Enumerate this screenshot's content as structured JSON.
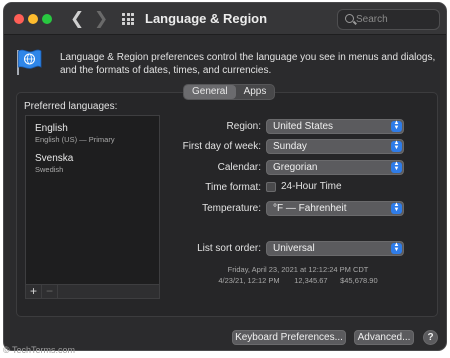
{
  "window": {
    "title": "Language & Region"
  },
  "search": {
    "placeholder": "Search"
  },
  "description": "Language & Region preferences control the language you see in menus and dialogs, and the formats of dates, times, and currencies.",
  "tabs": [
    {
      "label": "General",
      "active": true
    },
    {
      "label": "Apps",
      "active": false
    }
  ],
  "preferred_languages": {
    "label": "Preferred languages:",
    "items": [
      {
        "name": "English",
        "detail": "English (US) — Primary"
      },
      {
        "name": "Svenska",
        "detail": "Swedish"
      }
    ],
    "add_label": "+",
    "remove_label": "−"
  },
  "form": {
    "region": {
      "label": "Region:",
      "value": "United States"
    },
    "first_day": {
      "label": "First day of week:",
      "value": "Sunday"
    },
    "calendar": {
      "label": "Calendar:",
      "value": "Gregorian"
    },
    "time_format": {
      "label": "Time format:",
      "checkbox_label": "24-Hour Time",
      "checked": false
    },
    "temperature": {
      "label": "Temperature:",
      "value": "°F — Fahrenheit"
    },
    "sort_order": {
      "label": "List sort order:",
      "value": "Universal"
    }
  },
  "sample": {
    "line1": "Friday, April 23, 2021 at 12:12:24 PM CDT",
    "line2": "4/23/21, 12:12 PM       12,345.67      $45,678.90"
  },
  "buttons": {
    "keyboard": "Keyboard Preferences...",
    "advanced": "Advanced...",
    "help": "?"
  },
  "watermark": "© TechTerms.com",
  "colors": {
    "accent": "#2f7ce8",
    "window_bg": "#2b2b2d"
  }
}
